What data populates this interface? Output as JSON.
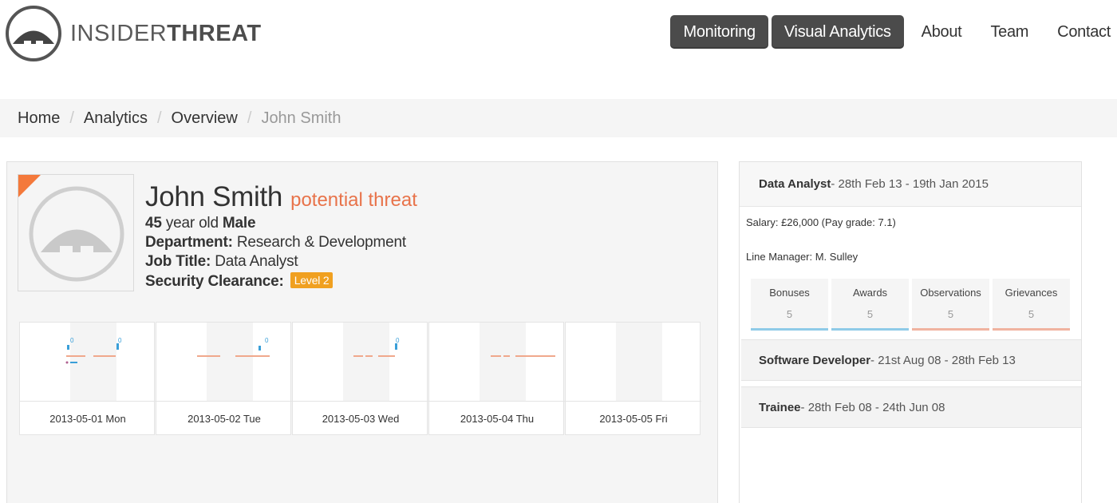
{
  "brand": {
    "name_light": "INSIDER",
    "name_bold": "THREAT"
  },
  "nav": {
    "buttons": [
      "Monitoring",
      "Visual Analytics"
    ],
    "links": [
      "About",
      "Team",
      "Contact"
    ]
  },
  "breadcrumb": [
    "Home",
    "Analytics",
    "Overview",
    "John Smith"
  ],
  "profile": {
    "name": "John Smith",
    "status": "potential threat",
    "age": "45",
    "age_suffix": "year old",
    "gender": "Male",
    "department_label": "Department:",
    "department": "Research & Development",
    "job_title_label": "Job Title:",
    "job_title": "Data Analyst",
    "clearance_label": "Security Clearance:",
    "clearance": "Level 2"
  },
  "days": [
    {
      "label": "2013-05-01 Mon",
      "annotations": [
        "0",
        "0"
      ]
    },
    {
      "label": "2013-05-02 Tue",
      "annotations": [
        "0"
      ]
    },
    {
      "label": "2013-05-03 Wed",
      "annotations": [
        "0"
      ]
    },
    {
      "label": "2013-05-04 Thu",
      "annotations": []
    },
    {
      "label": "2013-05-05 Fri",
      "annotations": []
    }
  ],
  "jobs": [
    {
      "title": "Data Analyst",
      "period": " - 28th Feb 13 - 19th Jan 2015",
      "salary": "Salary: £26,000 (Pay grade: 7.1)",
      "manager": "Line Manager: M. Sulley",
      "stats": [
        {
          "label": "Bonuses",
          "value": "5"
        },
        {
          "label": "Awards",
          "value": "5"
        },
        {
          "label": "Observations",
          "value": "5"
        },
        {
          "label": "Grievances",
          "value": "5"
        }
      ]
    },
    {
      "title": "Software Developer",
      "period": " - 21st Aug 08 - 28th Feb 13"
    },
    {
      "title": "Trainee",
      "period": " - 28th Feb 08 - 24th Jun 08"
    }
  ],
  "colors": {
    "accent_orange": "#f4793b",
    "threat_text": "#e8734a",
    "badge": "#f0a020",
    "nav_dark": "#4b4b4b",
    "timeline_orange": "#f0a88c",
    "timeline_blue": "#3a9fd8",
    "stat_blue": "#8fcbe8",
    "stat_red": "#f0b3a0"
  }
}
